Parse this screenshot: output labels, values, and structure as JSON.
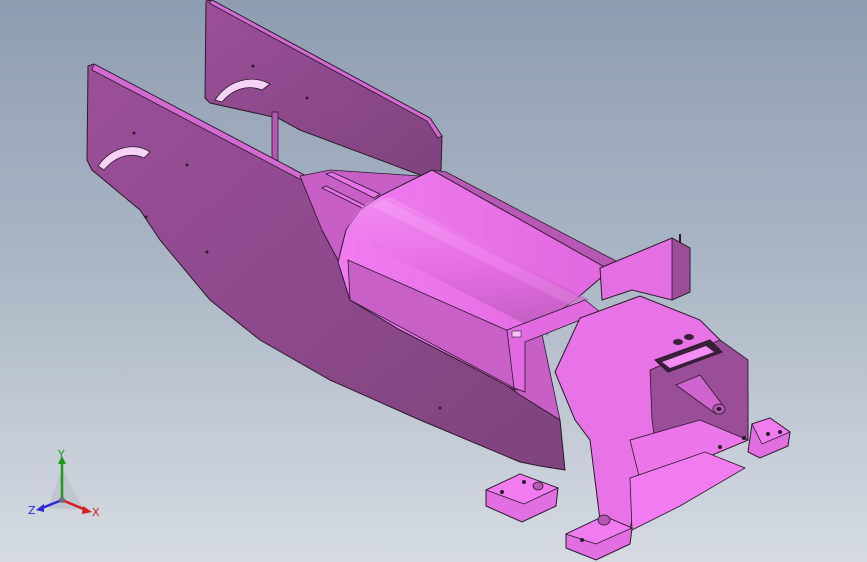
{
  "viewport": {
    "background_top": "#8e9db1",
    "background_bottom": "#d6dbe2"
  },
  "model": {
    "part_color": "#e96de8",
    "shade_color": "#8c4a8b",
    "edge_color": "#2a1a2a"
  },
  "triad": {
    "x_label": "X",
    "y_label": "Y",
    "z_label": "Z",
    "x_color": "#d42020",
    "y_color": "#1f9a1f",
    "z_color": "#2a2adb"
  }
}
